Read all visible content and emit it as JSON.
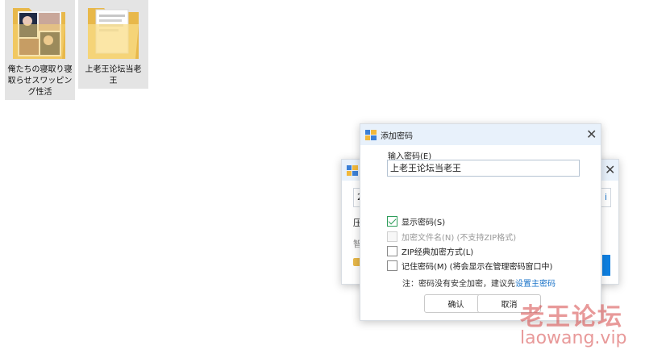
{
  "desktop": {
    "files": [
      {
        "name": "俺たちの寝取り寝取らせスワッピング性活",
        "icon": "folder-with-preview-icon"
      },
      {
        "name": "上老王论坛当老王",
        "icon": "folder-with-documents-icon"
      }
    ]
  },
  "back_dialog": {
    "input_partial": "2",
    "row1_partial": "压",
    "row2_partial": "智",
    "link_partial": "i",
    "close_glyph": "✕"
  },
  "password_dialog": {
    "title": "添加密码",
    "close_glyph": "✕",
    "input_label": "输入密码(E)",
    "input_value": "上老王论坛当老王",
    "options": [
      {
        "label": "显示密码(S)",
        "checked": true,
        "enabled": true
      },
      {
        "label": "加密文件名(N) (不支持ZIP格式)",
        "checked": false,
        "enabled": false
      },
      {
        "label": "ZIP经典加密方式(L)",
        "checked": false,
        "enabled": true
      },
      {
        "label": "记住密码(M) (将会显示在管理密码窗口中)",
        "checked": false,
        "enabled": true
      }
    ],
    "note_prefix": "注：密码没有安全加密，建议先",
    "note_link": "设置主密码",
    "ok_button": "确认",
    "cancel_button": "取消"
  },
  "watermark": {
    "line1": "老王论坛",
    "line2": "laowang.vip",
    "color": "#d64646"
  }
}
